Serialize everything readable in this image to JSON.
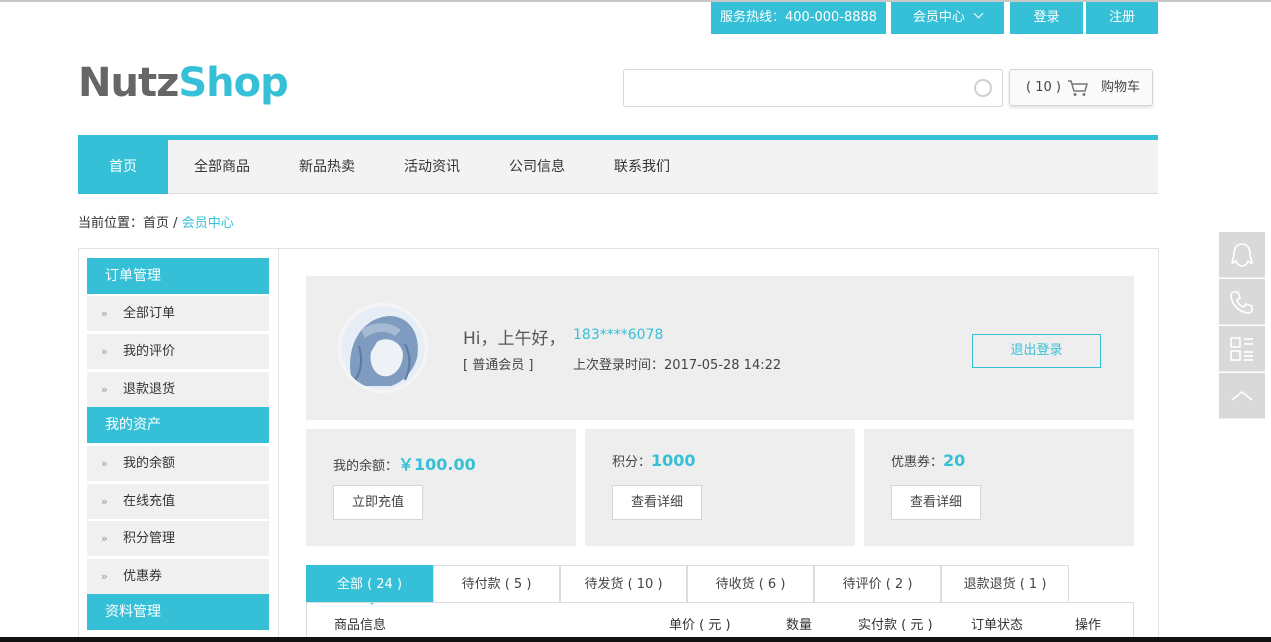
{
  "topbar": {
    "hotline": "服务热线：400-000-8888",
    "member_center": "会员中心",
    "login": "登录",
    "register": "注册"
  },
  "logo": {
    "part1": "Nutz",
    "part2": "Shop"
  },
  "search": {
    "value": "",
    "placeholder": ""
  },
  "cart": {
    "count": "( 10 )",
    "label": "购物车"
  },
  "nav": {
    "items": [
      {
        "label": "首页",
        "active": true
      },
      {
        "label": "全部商品"
      },
      {
        "label": "新品热卖"
      },
      {
        "label": "活动资讯"
      },
      {
        "label": "公司信息"
      },
      {
        "label": "联系我们"
      }
    ]
  },
  "breadcrumb": {
    "prefix": "当前位置：",
    "home": "首页",
    "sep": " / ",
    "current": "会员中心"
  },
  "sidebar": {
    "sections": [
      {
        "title": "订单管理",
        "items": [
          "全部订单",
          "我的评价",
          "退款退货"
        ]
      },
      {
        "title": "我的资产",
        "items": [
          "我的余额",
          "在线充值",
          "积分管理",
          "优惠券"
        ]
      },
      {
        "title": "资料管理",
        "items": []
      }
    ],
    "arrow": "»"
  },
  "profile": {
    "greeting": "Hi，上午好，",
    "phone": "183****6078",
    "level": "[ 普通会员 ]",
    "last_login": "上次登录时间：2017-05-28 14:22",
    "logout": "退出登录"
  },
  "stats": [
    {
      "label": "我的余额：",
      "value": "￥100.00",
      "button": "立即充值"
    },
    {
      "label": "积分：",
      "value": "1000",
      "button": "查看详细"
    },
    {
      "label": "优惠券：",
      "value": "20",
      "button": "查看详细"
    }
  ],
  "order_tabs": [
    "全部 ( 24 )",
    "待付款 ( 5 )",
    "待发货 ( 10 )",
    "待收货 ( 6 )",
    "待评价 ( 2 )",
    "退款退货 ( 1 )"
  ],
  "order_table": {
    "headers": [
      "商品信息",
      "单价 ( 元 )",
      "数量",
      "实付款 ( 元 )",
      "订单状态",
      "操作"
    ]
  },
  "float_bar": [
    "qq-icon",
    "phone-icon",
    "qrcode-icon",
    "back-to-top-icon"
  ],
  "colors": {
    "accent": "#35c0d7",
    "panel": "#eeeeee"
  }
}
